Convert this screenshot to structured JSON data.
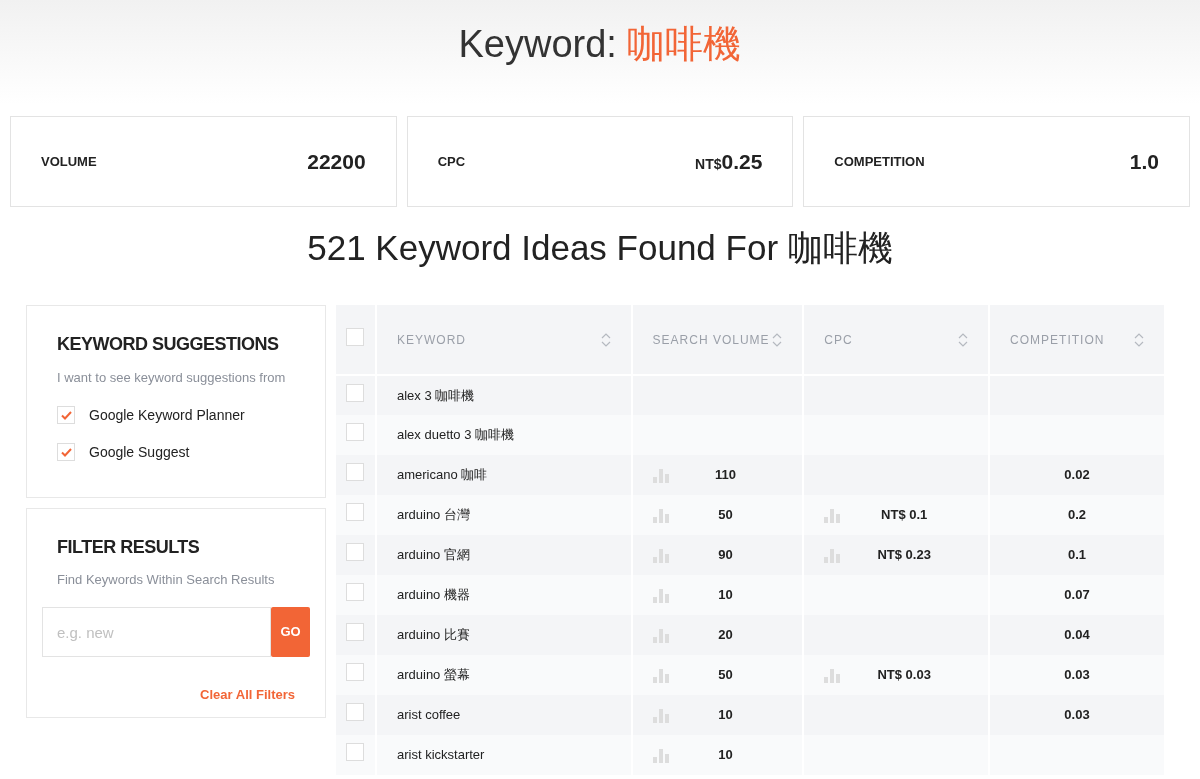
{
  "title": {
    "label": "Keyword: ",
    "keyword": "咖啡機"
  },
  "stats": [
    {
      "label": "VOLUME",
      "value": "22200"
    },
    {
      "label": "CPC",
      "currency": "NT$",
      "value": "0.25"
    },
    {
      "label": "COMPETITION",
      "value": "1.0"
    }
  ],
  "ideas_heading": "521 Keyword Ideas Found For 咖啡機",
  "suggestions": {
    "title": "KEYWORD SUGGESTIONS",
    "description": "I want to see keyword suggestions from",
    "sources": [
      {
        "label": "Google Keyword Planner",
        "checked": true
      },
      {
        "label": "Google Suggest",
        "checked": true
      }
    ]
  },
  "filter": {
    "title": "FILTER RESULTS",
    "description": "Find Keywords Within Search Results",
    "placeholder": "e.g. new",
    "button": "GO",
    "clear": "Clear All Filters"
  },
  "table": {
    "select_all": {
      "checked": false
    },
    "columns": [
      "KEYWORD",
      "SEARCH VOLUME",
      "CPC",
      "COMPETITION"
    ],
    "rows": [
      {
        "checked": false,
        "keyword": "alex 3 咖啡機"
      },
      {
        "checked": false,
        "keyword": "alex duetto 3 咖啡機"
      },
      {
        "checked": false,
        "keyword": "americano 咖啡",
        "volume": "110",
        "competition": "0.02"
      },
      {
        "checked": false,
        "keyword": "arduino 台灣",
        "volume": "50",
        "cpc": "NT$ 0.1",
        "competition": "0.2"
      },
      {
        "checked": false,
        "keyword": "arduino 官網",
        "volume": "90",
        "cpc": "NT$ 0.23",
        "competition": "0.1"
      },
      {
        "checked": false,
        "keyword": "arduino 機器",
        "volume": "10",
        "competition": "0.07"
      },
      {
        "checked": false,
        "keyword": "arduino 比賽",
        "volume": "20",
        "competition": "0.04"
      },
      {
        "checked": false,
        "keyword": "arduino 螢幕",
        "volume": "50",
        "cpc": "NT$ 0.03",
        "competition": "0.03"
      },
      {
        "checked": false,
        "keyword": "arist coffee",
        "volume": "10",
        "competition": "0.03"
      },
      {
        "checked": false,
        "keyword": "arist kickstarter",
        "volume": "10"
      }
    ]
  }
}
